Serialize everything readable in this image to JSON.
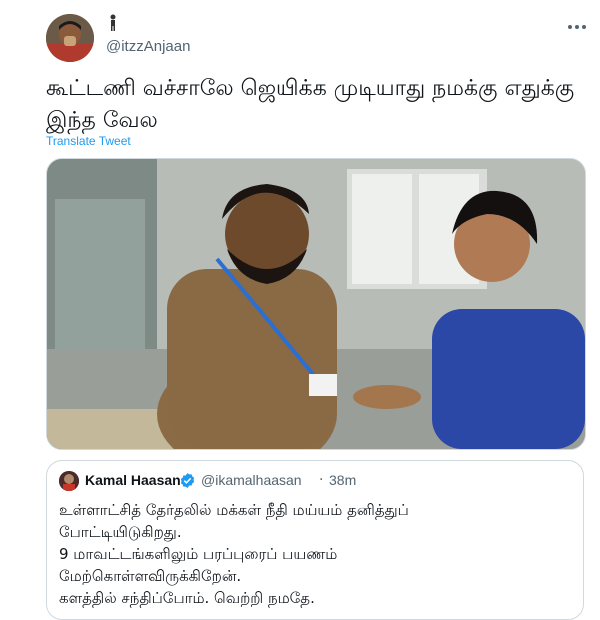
{
  "tweet": {
    "display_name": "",
    "handle": "@itzzAnjaan",
    "text": "கூட்டணி வச்சாலே ஜெயிக்க முடியாது நமக்கு எதுக்கு இந்த வேல",
    "translate_label": "Translate Tweet",
    "author_avatar_icon": "avatar",
    "more_icon": "more-horizontal-icon"
  },
  "quote": {
    "name": "Kamal Haasan",
    "verified": true,
    "verified_color": "#1d9bf0",
    "handle": "@ikamalhaasan",
    "separator": "·",
    "time": "38m",
    "lines": [
      "உள்ளாட்சித் தேர்தலில் மக்கள் நீதி மய்யம் தனித்துப்",
      "போட்டியிடுகிறது.",
      "9 மாவட்டங்களிலும் பரப்புரைப் பயணம்",
      "மேற்கொள்ளவிருக்கிறேன்.",
      "களத்தில் சந்திப்போம். வெற்றி நமதே."
    ]
  },
  "colors": {
    "link": "#1d9bf0",
    "text": "#0f1419",
    "muted": "#536471",
    "border": "#cfd9de"
  }
}
